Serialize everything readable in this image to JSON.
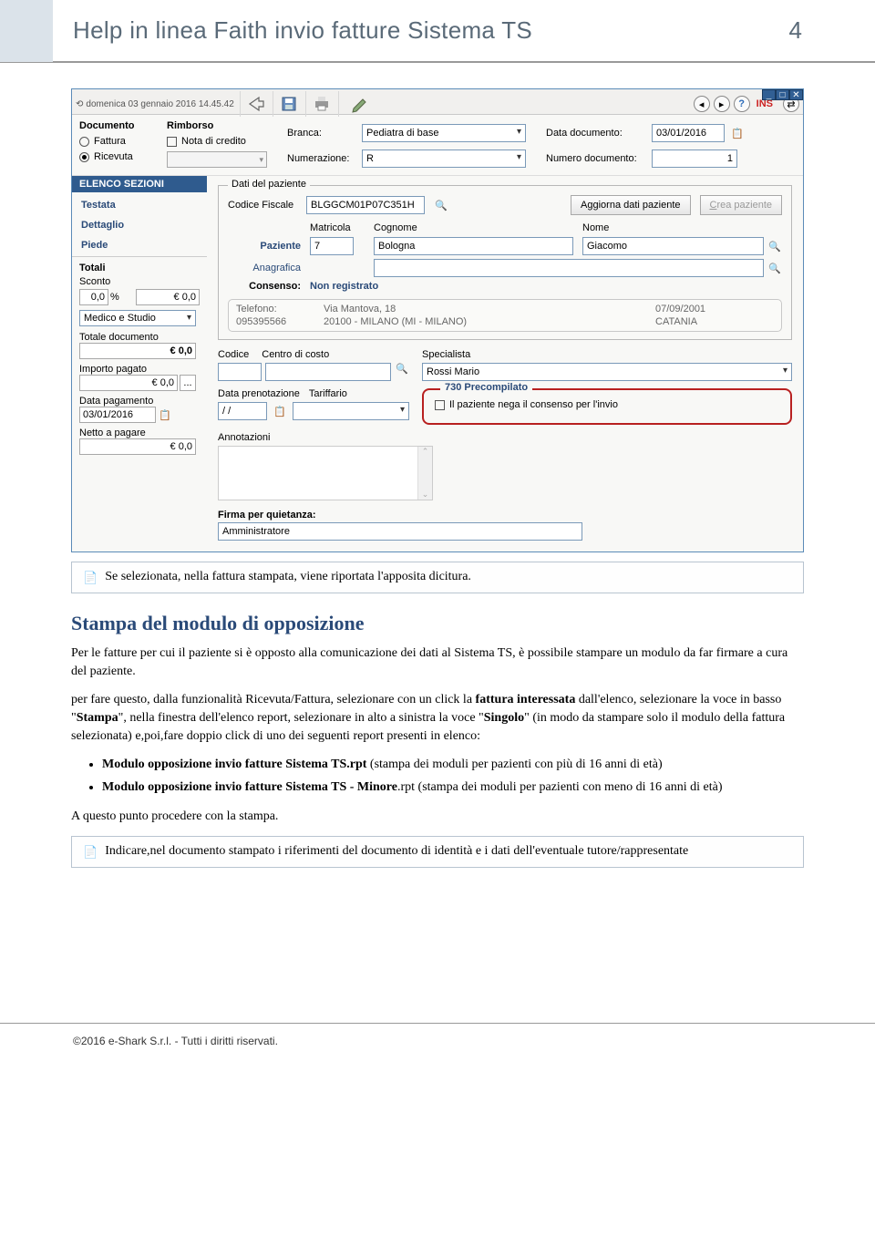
{
  "page": {
    "title": "Help in linea Faith invio fatture Sistema TS",
    "number": "4"
  },
  "toolbar": {
    "history": "domenica 03 gennaio 2016   14.45.42",
    "ins": "INS"
  },
  "docHeader": {
    "documentoLabel": "Documento",
    "fattura": "Fattura",
    "ricevuta": "Ricevuta",
    "rimborsoLabel": "Rimborso",
    "notaCredito": "Nota di credito",
    "brancaLabel": "Branca:",
    "brancaValue": "Pediatra di base",
    "numerazioneLabel": "Numerazione:",
    "numerazioneValue": "R",
    "dataDocLabel": "Data documento:",
    "dataDocValue": "03/01/2016",
    "numDocLabel": "Numero documento:",
    "numDocValue": "1"
  },
  "sections": {
    "header": "ELENCO SEZIONI",
    "testata": "Testata",
    "dettaglio": "Dettaglio",
    "piede": "Piede"
  },
  "totals": {
    "header": "Totali",
    "scontoLabel": "Sconto",
    "scontoPct": "0,0",
    "pctSymbol": "%",
    "scontoVal": "€ 0,0",
    "medicoStudio": "Medico e Studio",
    "totDocLabel": "Totale documento",
    "totDocVal": "€ 0,0",
    "impPagLabel": "Importo pagato",
    "impPagVal": "€ 0,0",
    "dots": "...",
    "dataPagLabel": "Data pagamento",
    "dataPagVal": "03/01/2016",
    "nettoLabel": "Netto a pagare",
    "nettoVal": "€ 0,0"
  },
  "paziente": {
    "legend": "Dati del paziente",
    "cfLabel": "Codice Fiscale",
    "cfValue": "BLGGCM01P07C351H",
    "aggiornaBtn": "Aggiorna dati paziente",
    "creaBtn": "Crea paziente",
    "matricolaLabel": "Matricola",
    "matricolaVal": "7",
    "cognomeLabel": "Cognome",
    "cognomeVal": "Bologna",
    "nomeLabel": "Nome",
    "nomeVal": "Giacomo",
    "pazienteLabel": "Paziente",
    "anagraficaLabel": "Anagrafica",
    "consensoLabel": "Consenso:",
    "consensoVal": "Non registrato",
    "telLabel": "Telefono:",
    "telVal": "095395566",
    "addr1": "Via Mantova, 18",
    "addr2": "20100 - MILANO (MI - MILANO)",
    "birthDate": "07/09/2001",
    "birthPlace": "CATANIA"
  },
  "lower": {
    "codiceLabel": "Codice",
    "centroLabel": "Centro di costo",
    "specialistaLabel": "Specialista",
    "specialistaVal": "Rossi Mario",
    "dataPrenLabel": "Data prenotazione",
    "dataPrenVal": "  /  /",
    "tariffarioLabel": "Tariffario",
    "precompLegend": "730 Precompilato",
    "negaConsenso": "Il paziente nega il consenso per l'invio",
    "annotazioniLabel": "Annotazioni",
    "firmaLabel": "Firma per quietanza:",
    "firmaVal": "Amministratore"
  },
  "notes": {
    "note1": "Se selezionata, nella fattura stampata, viene riportata l'apposita dicitura.",
    "note2": "Indicare,nel documento stampato i riferimenti del documento di identità e i dati dell'eventuale tutore/rappresentate"
  },
  "article": {
    "heading": "Stampa del modulo di opposizione",
    "p1": "Per le fatture per cui il paziente si è opposto alla comunicazione dei dati al Sistema TS, è possibile stampare un modulo da far firmare a cura del paziente.",
    "p2a": "per fare questo, dalla funzionalità Ricevuta/Fattura, selezionare con un click la ",
    "p2b": "fattura interessata",
    "p2c": " dall'elenco, selezionare la voce in basso \"",
    "p2d": "Stampa",
    "p2e": "\", nella finestra dell'elenco report, selezionare in alto a sinistra la voce \"",
    "p2f": "Singolo",
    "p2g": "\" (in modo da stampare solo il modulo della fattura selezionata) e,poi,fare doppio click di uno dei seguenti report presenti in elenco:",
    "li1a": "Modulo opposizione invio fatture Sistema TS.rpt",
    "li1b": " (stampa dei moduli per pazienti con più di 16 anni di età)",
    "li2a": "Modulo opposizione invio fatture Sistema TS - Minore",
    "li2b": ".rpt",
    "li2c": " (stampa dei moduli per pazienti con meno di 16 anni di età)",
    "p3": "A questo punto procedere con la stampa."
  },
  "footer": "©2016 e-Shark S.r.l. - Tutti i diritti riservati."
}
